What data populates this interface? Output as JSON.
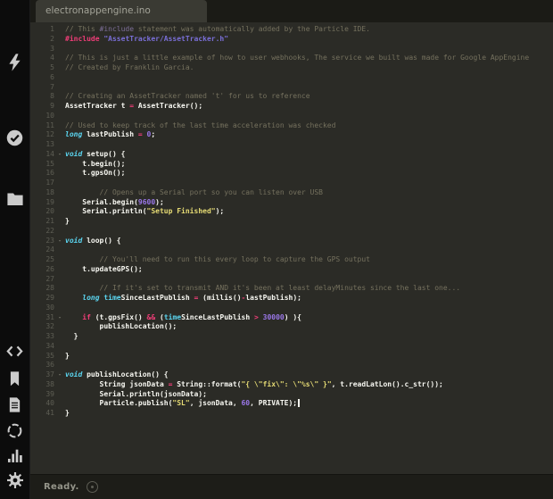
{
  "window_title": "electronappengine.ino",
  "colors": {
    "bg": "#2b2b26",
    "sidebar_bg": "#0c0c0c",
    "tabbar_bg": "#1b1b16",
    "tab_bg": "#3a3a33",
    "tab_text": "#a3a398",
    "text": "#f8f8f2",
    "comment": "#75715e",
    "comment_include": "#7d6f98",
    "keyword": "#ee3d77",
    "type": "#5bd5f0",
    "builtin": "#5bd5f0",
    "string": "#e6db74",
    "string_include": "#7a6fd8",
    "number": "#9a77e8",
    "line_number": "#5e5e54",
    "fold": "#8f8f82",
    "status_bg": "#1d1d18",
    "status_text": "#95958a",
    "cursor": "#f5f5ef",
    "icon": "#cbcbcb"
  },
  "sidebar": {
    "icons": [
      {
        "name": "flash-icon"
      },
      {
        "name": "check-circle-icon"
      },
      {
        "name": "folder-icon"
      },
      {
        "name": "code-icon"
      },
      {
        "name": "bookmark-icon"
      },
      {
        "name": "file-text-icon"
      },
      {
        "name": "spinner-icon"
      },
      {
        "name": "bar-chart-icon"
      },
      {
        "name": "gear-icon"
      }
    ]
  },
  "tab_bar": {
    "tabs": [
      {
        "label": "electronappengine.ino",
        "active": true
      }
    ]
  },
  "status_bar": {
    "text": "Ready.",
    "icon": "status-signal-icon"
  },
  "editor": {
    "language": "arduino-cpp",
    "lines": [
      {
        "n": 1,
        "seg": [
          {
            "c": "c",
            "t": "// This "
          },
          {
            "c": "ci",
            "t": "#include"
          },
          {
            "c": "c",
            "t": " statement was automatically added by the Particle IDE."
          }
        ]
      },
      {
        "n": 2,
        "seg": [
          {
            "c": "k",
            "t": "#include"
          },
          {
            "c": "p",
            "t": " "
          },
          {
            "c": "si",
            "t": "\"AssetTracker/AssetTracker.h\""
          }
        ]
      },
      {
        "n": 3,
        "seg": []
      },
      {
        "n": 4,
        "seg": [
          {
            "c": "c",
            "t": "// This is just a little example of how to user webhooks, The service we built was made for Google AppEngine"
          }
        ]
      },
      {
        "n": 5,
        "seg": [
          {
            "c": "c",
            "t": "// Created by Franklin Garcia."
          }
        ]
      },
      {
        "n": 6,
        "seg": []
      },
      {
        "n": 7,
        "seg": []
      },
      {
        "n": 8,
        "seg": [
          {
            "c": "c",
            "t": "// Creating an AssetTracker named 't' for us to reference"
          }
        ]
      },
      {
        "n": 9,
        "seg": [
          {
            "c": "p",
            "t": "AssetTracker t "
          },
          {
            "c": "k",
            "t": "="
          },
          {
            "c": "p",
            "t": " AssetTracker();"
          }
        ]
      },
      {
        "n": 10,
        "seg": []
      },
      {
        "n": 11,
        "seg": [
          {
            "c": "c",
            "t": "// Used to keep track of the last time acceleration was checked"
          }
        ]
      },
      {
        "n": 12,
        "seg": [
          {
            "c": "t",
            "t": "long"
          },
          {
            "c": "p",
            "t": " lastPublish "
          },
          {
            "c": "k",
            "t": "="
          },
          {
            "c": "p",
            "t": " "
          },
          {
            "c": "n",
            "t": "0"
          },
          {
            "c": "p",
            "t": ";"
          }
        ]
      },
      {
        "n": 13,
        "seg": []
      },
      {
        "n": 14,
        "fold": true,
        "seg": [
          {
            "c": "t",
            "t": "void"
          },
          {
            "c": "p",
            "t": " setup() {"
          }
        ]
      },
      {
        "n": 15,
        "seg": [
          {
            "c": "p",
            "t": "    t.begin();"
          }
        ]
      },
      {
        "n": 16,
        "seg": [
          {
            "c": "p",
            "t": "    t.gpsOn();"
          }
        ]
      },
      {
        "n": 17,
        "seg": []
      },
      {
        "n": 18,
        "seg": [
          {
            "c": "c",
            "t": "        // Opens up a Serial port so you can listen over USB"
          }
        ]
      },
      {
        "n": 19,
        "seg": [
          {
            "c": "p",
            "t": "    Serial.begin("
          },
          {
            "c": "n",
            "t": "9600"
          },
          {
            "c": "p",
            "t": ");"
          }
        ]
      },
      {
        "n": 20,
        "seg": [
          {
            "c": "p",
            "t": "    Serial.println("
          },
          {
            "c": "s",
            "t": "\"Setup Finished\""
          },
          {
            "c": "p",
            "t": ");"
          }
        ]
      },
      {
        "n": 21,
        "seg": [
          {
            "c": "p",
            "t": "}"
          }
        ]
      },
      {
        "n": 22,
        "seg": []
      },
      {
        "n": 23,
        "fold": true,
        "seg": [
          {
            "c": "t",
            "t": "void"
          },
          {
            "c": "p",
            "t": " loop() {"
          }
        ]
      },
      {
        "n": 24,
        "seg": []
      },
      {
        "n": 25,
        "seg": [
          {
            "c": "c",
            "t": "        // You'll need to run this every loop to capture the GPS output"
          }
        ]
      },
      {
        "n": 26,
        "seg": [
          {
            "c": "p",
            "t": "    t.updateGPS();"
          }
        ]
      },
      {
        "n": 27,
        "seg": []
      },
      {
        "n": 28,
        "seg": [
          {
            "c": "c",
            "t": "        // If it's set to transmit AND it's been at least delayMinutes since the last one..."
          }
        ]
      },
      {
        "n": 29,
        "seg": [
          {
            "c": "p",
            "t": "    "
          },
          {
            "c": "t",
            "t": "long"
          },
          {
            "c": "p",
            "t": " "
          },
          {
            "c": "b",
            "t": "time"
          },
          {
            "c": "p",
            "t": "SinceLastPublish "
          },
          {
            "c": "k",
            "t": "="
          },
          {
            "c": "p",
            "t": " (millis()"
          },
          {
            "c": "k",
            "t": "-"
          },
          {
            "c": "p",
            "t": "lastPublish);"
          }
        ]
      },
      {
        "n": 30,
        "seg": []
      },
      {
        "n": 31,
        "fold": true,
        "seg": [
          {
            "c": "p",
            "t": "    "
          },
          {
            "c": "k",
            "t": "if"
          },
          {
            "c": "p",
            "t": " (t.gpsFix() "
          },
          {
            "c": "k",
            "t": "&&"
          },
          {
            "c": "p",
            "t": " ("
          },
          {
            "c": "b",
            "t": "time"
          },
          {
            "c": "p",
            "t": "SinceLastPublish "
          },
          {
            "c": "k",
            "t": ">"
          },
          {
            "c": "p",
            "t": " "
          },
          {
            "c": "n",
            "t": "30000"
          },
          {
            "c": "p",
            "t": ") ){"
          }
        ]
      },
      {
        "n": 32,
        "seg": [
          {
            "c": "p",
            "t": "        publishLocation();"
          }
        ]
      },
      {
        "n": 33,
        "seg": [
          {
            "c": "p",
            "t": "  }"
          }
        ]
      },
      {
        "n": 34,
        "seg": []
      },
      {
        "n": 35,
        "seg": [
          {
            "c": "p",
            "t": "}"
          }
        ]
      },
      {
        "n": 36,
        "seg": []
      },
      {
        "n": 37,
        "fold": true,
        "seg": [
          {
            "c": "t",
            "t": "void"
          },
          {
            "c": "p",
            "t": " publishLocation() {"
          }
        ]
      },
      {
        "n": 38,
        "seg": [
          {
            "c": "p",
            "t": "        String jsonData "
          },
          {
            "c": "k",
            "t": "="
          },
          {
            "c": "p",
            "t": " String::format("
          },
          {
            "c": "s",
            "t": "\"{ \\\"fix\\\": \\\"%s\\\" }\""
          },
          {
            "c": "p",
            "t": ", t.readLatLon().c_str());"
          }
        ]
      },
      {
        "n": 39,
        "seg": [
          {
            "c": "p",
            "t": "        Serial.println(jsonData);"
          }
        ]
      },
      {
        "n": 40,
        "cursor": true,
        "seg": [
          {
            "c": "p",
            "t": "        Particle.publish("
          },
          {
            "c": "s",
            "t": "\"SL\""
          },
          {
            "c": "p",
            "t": ", jsonData, "
          },
          {
            "c": "n",
            "t": "60"
          },
          {
            "c": "p",
            "t": ", PRIVATE);"
          }
        ]
      },
      {
        "n": 41,
        "seg": [
          {
            "c": "p",
            "t": "}"
          }
        ]
      }
    ]
  }
}
